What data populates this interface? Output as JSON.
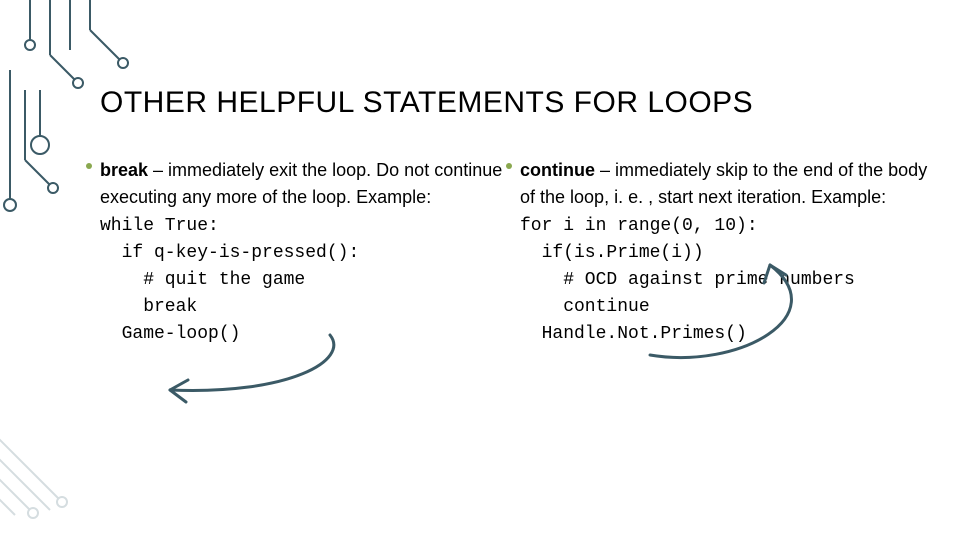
{
  "title": "OTHER HELPFUL STATEMENTS FOR LOOPS",
  "left": {
    "keyword": "break",
    "desc_rest": " – immediately exit the loop. Do not continue executing any more of the loop. Example:",
    "code": "while True:\n  if q-key-is-pressed():\n    # quit the game\n    break\n  Game-loop()"
  },
  "right": {
    "keyword": "continue",
    "desc_rest": " – immediately skip to the end of the body of the loop, i. e. , start next iteration. Example:",
    "code": "for i in range(0, 10):\n  if(is.Prime(i))\n    # OCD against prime numbers\n    continue\n  Handle.Not.Primes()"
  },
  "colors": {
    "circuit": "#3b5a66",
    "bullet": "#8aa84f",
    "arrow": "#3b5a66"
  }
}
